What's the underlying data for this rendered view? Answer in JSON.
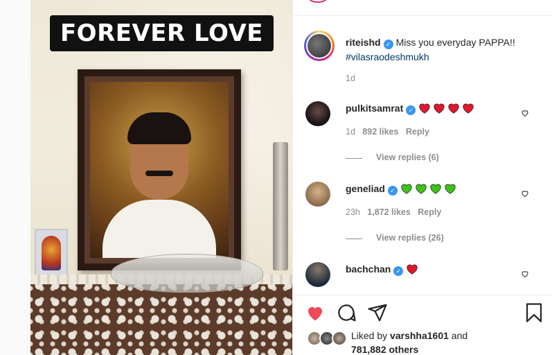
{
  "post": {
    "overlay_text": "FOREVER LOVE"
  },
  "caption": {
    "username": "riteishd",
    "text": "Miss you everyday PAPPA!!",
    "hashtag": "#vilasraodeshmukh",
    "time": "1d"
  },
  "comments": [
    {
      "username": "pulkitsamrat",
      "hearts": 4,
      "heart_color": "#e0182d",
      "time": "1d",
      "likes": "892 likes",
      "reply": "Reply",
      "view_replies": "View replies (6)"
    },
    {
      "username": "geneliad",
      "hearts": 4,
      "heart_color": "#3cc21a",
      "time": "23h",
      "likes": "1,872 likes",
      "reply": "Reply",
      "view_replies": "View replies (26)"
    },
    {
      "username": "bachchan",
      "hearts": 1,
      "heart_color": "#e0182d"
    }
  ],
  "likes": {
    "prefix": "Liked by",
    "user": "varshha1601",
    "conjunction": "and",
    "count": "781,882 others"
  },
  "colors": {
    "like_red": "#ed4956",
    "verified_blue": "#3897f0",
    "hashtag_blue": "#00376b"
  },
  "icons": [
    "heart-filled-icon",
    "comment-icon",
    "share-icon",
    "bookmark-icon",
    "heart-outline-icon",
    "verified-icon"
  ]
}
